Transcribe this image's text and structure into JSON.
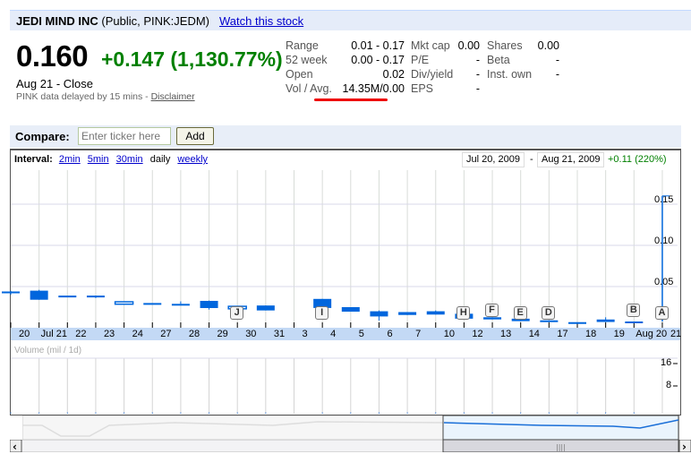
{
  "header": {
    "company": "JEDI MIND INC",
    "listing": "(Public, PINK:JEDM)",
    "watch_link": "Watch this stock"
  },
  "quote": {
    "price": "0.160",
    "change": "+0.147 (1,130.77%)",
    "date_status": "Aug 21 - Close",
    "delay_note": "PINK data delayed by 15 mins - ",
    "disclaimer": "Disclaimer",
    "change_color": "#008000"
  },
  "stats": {
    "col1": [
      {
        "label": "Range",
        "value": "0.01 - 0.17"
      },
      {
        "label": "52 week",
        "value": "0.00 - 0.17"
      },
      {
        "label": "Open",
        "value": "0.02"
      },
      {
        "label": "Vol / Avg.",
        "value": "14.35M/0.00"
      }
    ],
    "col2": [
      {
        "label": "Mkt cap",
        "value": "0.00"
      },
      {
        "label": "P/E",
        "value": "-"
      },
      {
        "label": "Div/yield",
        "value": "-"
      },
      {
        "label": "EPS",
        "value": "-"
      }
    ],
    "col3": [
      {
        "label": "Shares",
        "value": "0.00"
      },
      {
        "label": "Beta",
        "value": "-"
      },
      {
        "label": "Inst. own",
        "value": "-"
      }
    ],
    "highlight_color": "#ee0000"
  },
  "compare": {
    "label": "Compare:",
    "placeholder": "Enter ticker here",
    "add_button": "Add"
  },
  "chart_toolbar": {
    "interval_label": "Interval:",
    "intervals": [
      "2min",
      "5min",
      "30min",
      "daily",
      "weekly"
    ],
    "selected_interval": "daily",
    "start_date": "Jul 20, 2009",
    "date_sep": "-",
    "end_date": "Aug 21, 2009",
    "period_change": "+0.11 (220%)"
  },
  "chart_data": {
    "type": "candlestick",
    "categories": [
      "20",
      "Jul 21",
      "22",
      "23",
      "24",
      "27",
      "28",
      "29",
      "30",
      "31",
      "3",
      "4",
      "5",
      "6",
      "7",
      "10",
      "12",
      "13",
      "14",
      "17",
      "18",
      "19",
      "Aug 20",
      "21"
    ],
    "ohlc": [
      [
        0.044,
        0.045,
        0.04,
        0.044
      ],
      [
        0.045,
        0.046,
        0.034,
        0.034
      ],
      [
        0.039,
        0.039,
        0.039,
        0.039
      ],
      [
        0.039,
        0.039,
        0.036,
        0.038
      ],
      [
        0.0286,
        0.0315,
        0.0286,
        0.0315
      ],
      [
        0.03,
        0.03,
        0.03,
        0.03
      ],
      [
        0.029,
        0.032,
        0.029,
        0.029
      ],
      [
        0.0326,
        0.033,
        0.022,
        0.0239
      ],
      [
        0.023,
        0.026,
        0.023,
        0.026
      ],
      [
        0.027,
        0.027,
        0.021,
        0.021
      ],
      null,
      [
        0.035,
        0.035,
        0.024,
        0.024
      ],
      [
        0.025,
        0.025,
        0.0195,
        0.0195
      ],
      [
        0.02,
        0.021,
        0.0087,
        0.0137
      ],
      [
        0.019,
        0.019,
        0.0155,
        0.0155
      ],
      [
        0.02,
        0.021,
        0.016,
        0.016
      ],
      [
        0.017,
        0.017,
        0.011,
        0.011
      ],
      [
        0.0127,
        0.0127,
        0.0101,
        0.0101
      ],
      [
        0.011,
        0.011,
        0.008,
        0.008
      ],
      [
        0.009,
        0.009,
        0.007,
        0.007
      ],
      [
        0.0068,
        0.0068,
        0.0068,
        0.0068
      ],
      [
        0.01,
        0.0127,
        0.007,
        0.007
      ],
      [
        0.0076,
        0.0076,
        0.0076,
        0.0076
      ],
      [
        0.0076,
        0.16,
        0.0076,
        0.16
      ]
    ],
    "y_ticks": [
      "0.15",
      "0.10",
      "0.05"
    ],
    "ylim": [
      0,
      0.17
    ],
    "events": [
      {
        "label": "J",
        "date": "30"
      },
      {
        "label": "I",
        "date": "4"
      },
      {
        "label": "H",
        "date": "12"
      },
      {
        "label": "F",
        "date": "13"
      },
      {
        "label": "E",
        "date": "14"
      },
      {
        "label": "D",
        "date": "17"
      },
      {
        "label": "B",
        "date": "Aug 20"
      },
      {
        "label": "A",
        "date": "21"
      }
    ],
    "volume": {
      "label": "Volume (mil / 1d)",
      "ticks": [
        "16",
        "8"
      ],
      "ylim": [
        0,
        18
      ]
    },
    "up_color": "#ffffff",
    "down_color": "#0066dd",
    "grid": true
  }
}
